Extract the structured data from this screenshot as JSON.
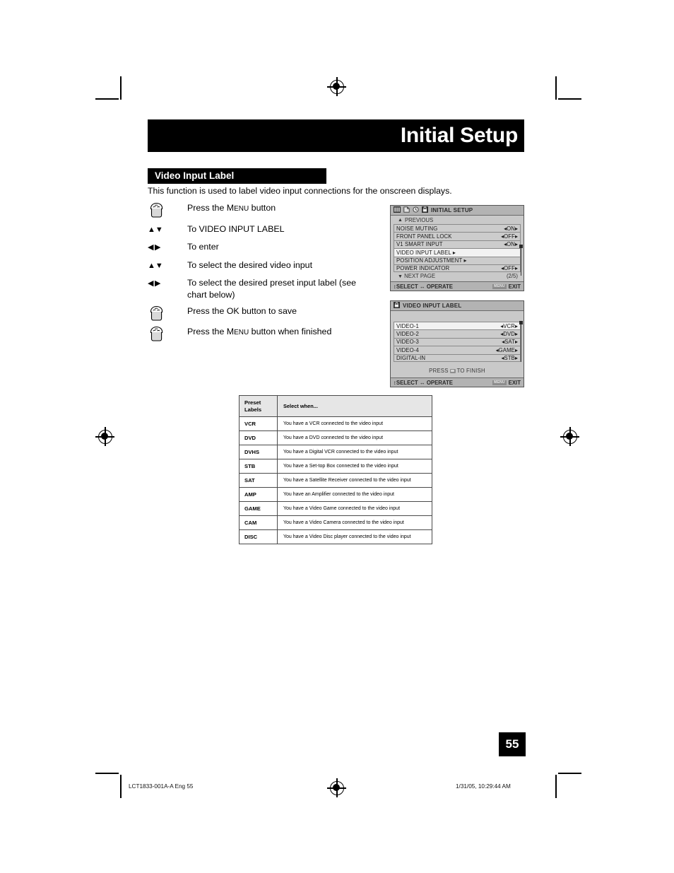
{
  "page": {
    "chapter_title": "Initial Setup",
    "section_title": "Video Input Label",
    "intro": "This function is used to label video input connections for the onscreen displays.",
    "page_number": "55"
  },
  "steps": [
    {
      "icon": "hand-press-icon",
      "text_pre": "Press the M",
      "text_sc": "ENU",
      "text_post": " button"
    },
    {
      "icon": "up-down-arrows-icon",
      "text_pre": "To VIDEO INPUT LABEL",
      "text_sc": "",
      "text_post": ""
    },
    {
      "icon": "left-right-arrows-icon",
      "text_pre": "To enter",
      "text_sc": "",
      "text_post": ""
    },
    {
      "icon": "up-down-arrows-icon",
      "text_pre": "To select the desired video input",
      "text_sc": "",
      "text_post": ""
    },
    {
      "icon": "left-right-arrows-icon",
      "text_pre": "To select the desired preset input label (see chart below)",
      "text_sc": "",
      "text_post": ""
    },
    {
      "icon": "hand-press-icon",
      "text_pre": "Press the OK button to save",
      "text_sc": "",
      "text_post": ""
    },
    {
      "icon": "hand-press-icon",
      "text_pre": "Press the M",
      "text_sc": "ENU",
      "text_post": " button when finished"
    }
  ],
  "osd_initial_setup": {
    "title": "INITIAL SETUP",
    "tab_icons": [
      "bars-icon",
      "page-icon",
      "clock-icon",
      "setup-lock-icon"
    ],
    "previous_label": "PREVIOUS",
    "rows": [
      {
        "label": "NOISE MUTING",
        "value": "ON",
        "selected": false,
        "arrow": false
      },
      {
        "label": "FRONT PANEL LOCK",
        "value": "OFF",
        "selected": false,
        "arrow": false
      },
      {
        "label": "V1 SMART INPUT",
        "value": "ON",
        "selected": false,
        "arrow": false
      },
      {
        "label": "VIDEO INPUT LABEL",
        "value": "",
        "selected": true,
        "arrow": true
      },
      {
        "label": "POSITION ADJUSTMENT",
        "value": "",
        "selected": false,
        "arrow": true
      },
      {
        "label": "POWER INDICATOR",
        "value": "OFF",
        "selected": false,
        "arrow": false
      }
    ],
    "next_page_label": "NEXT PAGE",
    "page_indicator": "(2/5)",
    "footer_left": "SELECT",
    "footer_mid": "OPERATE",
    "footer_menu_chip": "MENU",
    "footer_right": "EXIT"
  },
  "osd_video_input_label": {
    "title": "VIDEO INPUT LABEL",
    "title_icon": "setup-lock-icon",
    "rows": [
      {
        "label": "VIDEO-1",
        "value": "VCR"
      },
      {
        "label": "VIDEO-2",
        "value": "DVD"
      },
      {
        "label": "VIDEO-3",
        "value": "SAT"
      },
      {
        "label": "VIDEO-4",
        "value": "GAME"
      },
      {
        "label": "DIGITAL-IN",
        "value": "STB"
      }
    ],
    "press_prefix": "PRESS",
    "press_suffix": "TO FINISH",
    "footer_left": "SELECT",
    "footer_mid": "OPERATE",
    "footer_menu_chip": "MENU",
    "footer_right": "EXIT"
  },
  "preset_table": {
    "headers": [
      "Preset\nLabels",
      "Select when..."
    ],
    "header_col1_line1": "Preset",
    "header_col1_line2": "Labels",
    "header_col2": "Select when...",
    "rows": [
      {
        "label": "VCR",
        "desc": "You have a VCR connected to the video input"
      },
      {
        "label": "DVD",
        "desc": "You have a DVD connected to the video input"
      },
      {
        "label": "DVHS",
        "desc": "You have a Digital VCR connected to the video input"
      },
      {
        "label": "STB",
        "desc": "You have a Set-top Box connected to the video input"
      },
      {
        "label": "SAT",
        "desc": "You have a Satellite Receiver connected to the video input"
      },
      {
        "label": "AMP",
        "desc": "You have an Amplifier connected to the video input"
      },
      {
        "label": "GAME",
        "desc": "You have a Video Game connected to the video input"
      },
      {
        "label": "CAM",
        "desc": "You have a Video Camera connected to the video input"
      },
      {
        "label": "DISC",
        "desc": "You have a Video Disc player connected to the video input"
      }
    ]
  },
  "footer": {
    "left": "LCT1833-001A-A Eng  55",
    "right": "1/31/05, 10:29:44 AM"
  }
}
